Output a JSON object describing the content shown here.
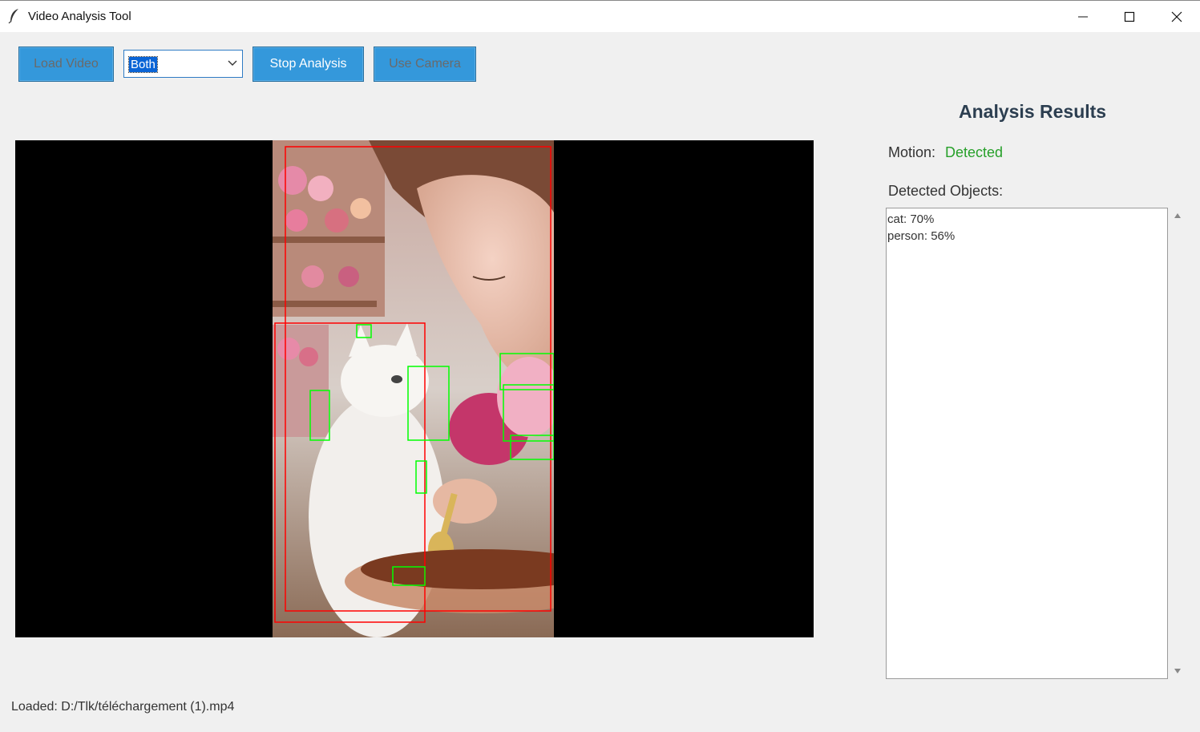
{
  "window": {
    "title": "Video Analysis Tool"
  },
  "toolbar": {
    "load_video_label": "Load Video",
    "mode_select_value": "Both",
    "stop_analysis_label": "Stop Analysis",
    "use_camera_label": "Use Camera"
  },
  "results": {
    "title": "Analysis Results",
    "motion_label": "Motion:",
    "motion_value": "Detected",
    "objects_label": "Detected Objects:",
    "objects": [
      "cat: 70%",
      "person: 56%"
    ]
  },
  "status_text": "Loaded: D:/Tlk/téléchargement (1).mp4",
  "colors": {
    "button_bg": "#3498db",
    "motion_detected": "#27a02a",
    "title_color": "#2c3e50",
    "object_box": "#ff0000",
    "motion_box": "#00ff00"
  }
}
